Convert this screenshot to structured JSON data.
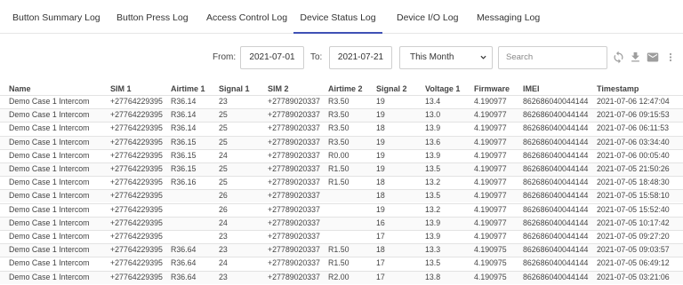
{
  "tabs": [
    {
      "label": "Button Summary Log",
      "active": false
    },
    {
      "label": "Button Press Log",
      "active": false
    },
    {
      "label": "Access Control Log",
      "active": false
    },
    {
      "label": "Device Status Log",
      "active": true
    },
    {
      "label": "Device I/O Log",
      "active": false
    },
    {
      "label": "Messaging Log",
      "active": false
    }
  ],
  "filters": {
    "from_label": "From:",
    "from_value": "2021-07-01",
    "to_label": "To:",
    "to_value": "2021-07-21",
    "period_value": "This Month",
    "search_placeholder": "Search"
  },
  "toolbar_icons": [
    "refresh-icon",
    "download-icon",
    "email-icon",
    "more-vertical-icon"
  ],
  "accent_color": "#3f51b5",
  "table": {
    "columns": [
      "Name",
      "SIM 1",
      "Airtime 1",
      "Signal 1",
      "SIM 2",
      "Airtime 2",
      "Signal 2",
      "Voltage 1",
      "Firmware",
      "IMEI",
      "Timestamp"
    ],
    "rows": [
      [
        "Demo Case 1 Intercom",
        "+27764229395",
        "R36.14",
        "23",
        "+27789020337",
        "R3.50",
        "19",
        "13.4",
        "4.190977",
        "862686040044144",
        "2021-07-06 12:47:04"
      ],
      [
        "Demo Case 1 Intercom",
        "+27764229395",
        "R36.14",
        "25",
        "+27789020337",
        "R3.50",
        "19",
        "13.0",
        "4.190977",
        "862686040044144",
        "2021-07-06 09:15:53"
      ],
      [
        "Demo Case 1 Intercom",
        "+27764229395",
        "R36.14",
        "25",
        "+27789020337",
        "R3.50",
        "18",
        "13.9",
        "4.190977",
        "862686040044144",
        "2021-07-06 06:11:53"
      ],
      [
        "Demo Case 1 Intercom",
        "+27764229395",
        "R36.15",
        "25",
        "+27789020337",
        "R3.50",
        "19",
        "13.6",
        "4.190977",
        "862686040044144",
        "2021-07-06 03:34:40"
      ],
      [
        "Demo Case 1 Intercom",
        "+27764229395",
        "R36.15",
        "24",
        "+27789020337",
        "R0.00",
        "19",
        "13.9",
        "4.190977",
        "862686040044144",
        "2021-07-06 00:05:40"
      ],
      [
        "Demo Case 1 Intercom",
        "+27764229395",
        "R36.15",
        "25",
        "+27789020337",
        "R1.50",
        "19",
        "13.5",
        "4.190977",
        "862686040044144",
        "2021-07-05 21:50:26"
      ],
      [
        "Demo Case 1 Intercom",
        "+27764229395",
        "R36.16",
        "25",
        "+27789020337",
        "R1.50",
        "18",
        "13.2",
        "4.190977",
        "862686040044144",
        "2021-07-05 18:48:30"
      ],
      [
        "Demo Case 1 Intercom",
        "+27764229395",
        "",
        "26",
        "+27789020337",
        "",
        "18",
        "13.5",
        "4.190977",
        "862686040044144",
        "2021-07-05 15:58:10"
      ],
      [
        "Demo Case 1 Intercom",
        "+27764229395",
        "",
        "26",
        "+27789020337",
        "",
        "19",
        "13.2",
        "4.190977",
        "862686040044144",
        "2021-07-05 15:52:40"
      ],
      [
        "Demo Case 1 Intercom",
        "+27764229395",
        "",
        "24",
        "+27789020337",
        "",
        "16",
        "13.9",
        "4.190977",
        "862686040044144",
        "2021-07-05 10:17:42"
      ],
      [
        "Demo Case 1 Intercom",
        "+27764229395",
        "",
        "23",
        "+27789020337",
        "",
        "17",
        "13.9",
        "4.190977",
        "862686040044144",
        "2021-07-05 09:27:20"
      ],
      [
        "Demo Case 1 Intercom",
        "+27764229395",
        "R36.64",
        "23",
        "+27789020337",
        "R1.50",
        "18",
        "13.3",
        "4.190975",
        "862686040044144",
        "2021-07-05 09:03:57"
      ],
      [
        "Demo Case 1 Intercom",
        "+27764229395",
        "R36.64",
        "24",
        "+27789020337",
        "R1.50",
        "17",
        "13.5",
        "4.190975",
        "862686040044144",
        "2021-07-05 06:49:12"
      ],
      [
        "Demo Case 1 Intercom",
        "+27764229395",
        "R36.64",
        "23",
        "+27789020337",
        "R2.00",
        "17",
        "13.8",
        "4.190975",
        "862686040044144",
        "2021-07-05 03:21:06"
      ]
    ]
  }
}
